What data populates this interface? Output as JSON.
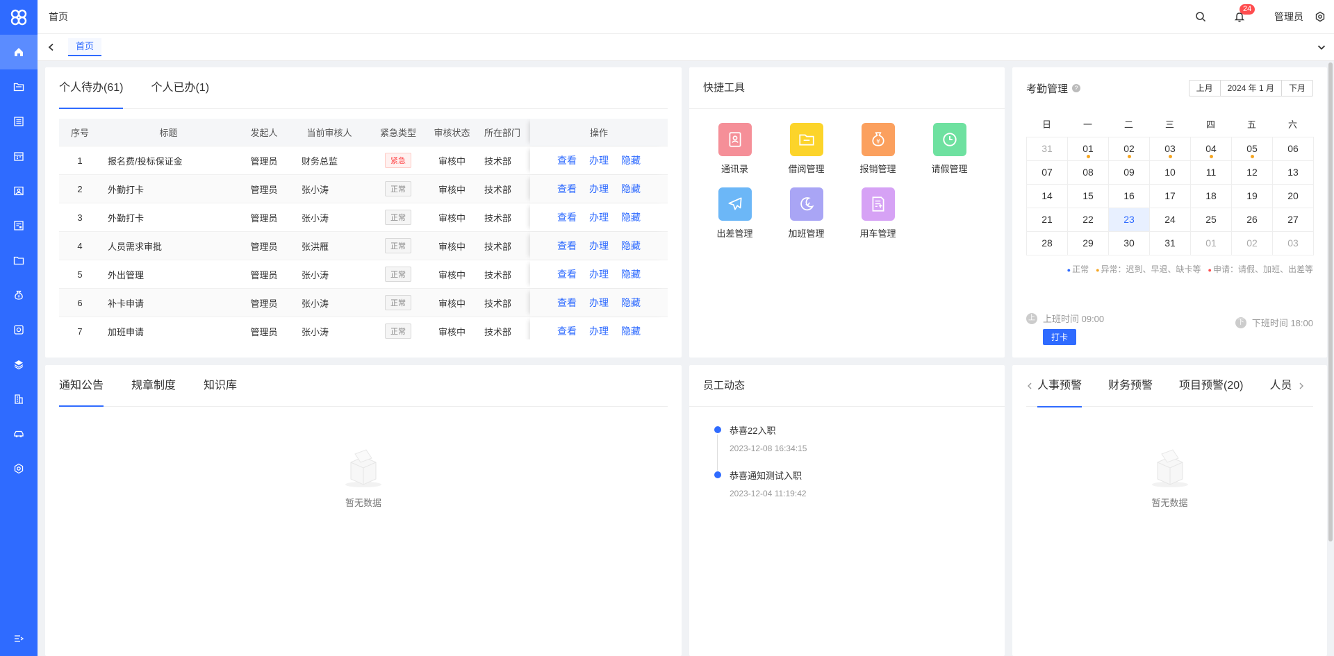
{
  "header": {
    "breadcrumb": "首页",
    "notifications": "24",
    "user": "管理员"
  },
  "tabsbar": {
    "tab": "首页"
  },
  "todo": {
    "tabs": [
      "个人待办(61)",
      "个人已办(1)"
    ],
    "columns": [
      "序号",
      "标题",
      "发起人",
      "当前审核人",
      "紧急类型",
      "审核状态",
      "所在部门",
      "操作"
    ],
    "ops": [
      "查看",
      "办理",
      "隐藏"
    ],
    "rows": [
      {
        "seq": "1",
        "title": "报名费/投标保证金",
        "from": "管理员",
        "auditor": "财务总监",
        "urgency": "紧急",
        "status": "审核中",
        "dept": "技术部"
      },
      {
        "seq": "2",
        "title": "外勤打卡",
        "from": "管理员",
        "auditor": "张小涛",
        "urgency": "正常",
        "status": "审核中",
        "dept": "技术部"
      },
      {
        "seq": "3",
        "title": "外勤打卡",
        "from": "管理员",
        "auditor": "张小涛",
        "urgency": "正常",
        "status": "审核中",
        "dept": "技术部"
      },
      {
        "seq": "4",
        "title": "人员需求审批",
        "from": "管理员",
        "auditor": "张洪雁",
        "urgency": "正常",
        "status": "审核中",
        "dept": "技术部"
      },
      {
        "seq": "5",
        "title": "外出管理",
        "from": "管理员",
        "auditor": "张小涛",
        "urgency": "正常",
        "status": "审核中",
        "dept": "技术部"
      },
      {
        "seq": "6",
        "title": "补卡申请",
        "from": "管理员",
        "auditor": "张小涛",
        "urgency": "正常",
        "status": "审核中",
        "dept": "技术部"
      },
      {
        "seq": "7",
        "title": "加班申请",
        "from": "管理员",
        "auditor": "张小涛",
        "urgency": "正常",
        "status": "审核中",
        "dept": "技术部"
      }
    ]
  },
  "tools": {
    "title": "快捷工具",
    "items": [
      {
        "label": "通讯录",
        "color": "#f58f98",
        "icon": "contacts-icon"
      },
      {
        "label": "借阅管理",
        "color": "#fcd42a",
        "icon": "folder-icon"
      },
      {
        "label": "报销管理",
        "color": "#fba05e",
        "icon": "moneybag-icon"
      },
      {
        "label": "请假管理",
        "color": "#6ee1a0",
        "icon": "clock-icon"
      },
      {
        "label": "出差管理",
        "color": "#6cb7f7",
        "icon": "plane-icon"
      },
      {
        "label": "加班管理",
        "color": "#a9a5f5",
        "icon": "moon-icon"
      },
      {
        "label": "用车管理",
        "color": "#d6a2f5",
        "icon": "document-icon"
      }
    ]
  },
  "attendance": {
    "title": "考勤管理",
    "prev": "上月",
    "month": "2024 年 1 月",
    "next": "下月",
    "weekdays": [
      "日",
      "一",
      "二",
      "三",
      "四",
      "五",
      "六"
    ],
    "legend": [
      "正常",
      "异常：迟到、早退、缺卡等",
      "申请：请假、加班、出差等"
    ],
    "onwork_icon": "上",
    "onwork": "上班时间 09:00",
    "punch": "打卡",
    "offwork_icon": "下",
    "offwork": "下班时间 18:00"
  },
  "notice": {
    "tabs": [
      "通知公告",
      "规章制度",
      "知识库"
    ],
    "empty": "暂无数据"
  },
  "staff": {
    "title": "员工动态",
    "items": [
      {
        "text": "恭喜22入职",
        "time": "2023-12-08 16:34:15"
      },
      {
        "text": "恭喜通知测试入职",
        "time": "2023-12-04 11:19:42"
      }
    ]
  },
  "warn": {
    "tabs": [
      "人事预警",
      "财务预警",
      "项目预警(20)",
      "人员"
    ],
    "empty": "暂无数据"
  }
}
